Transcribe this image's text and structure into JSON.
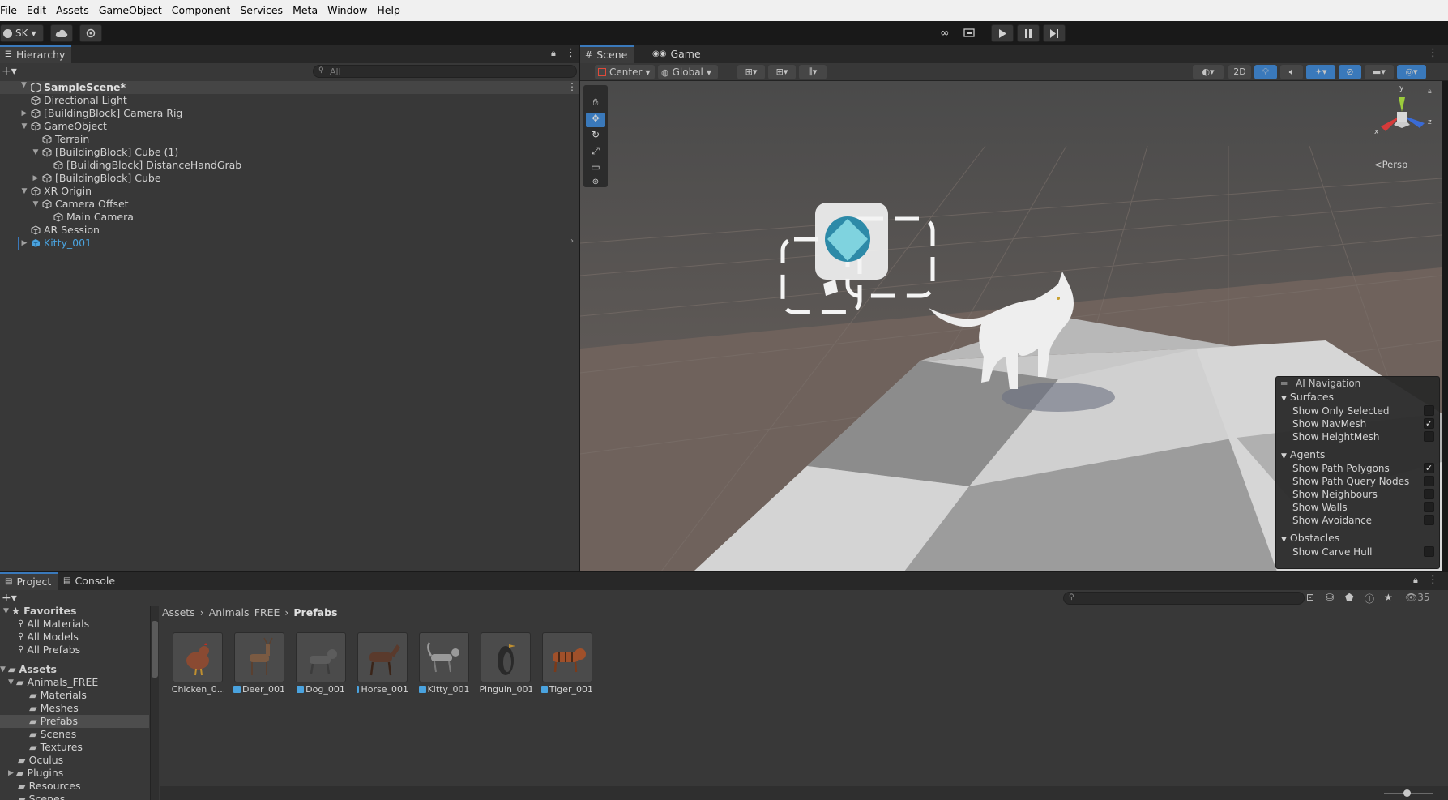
{
  "menu": [
    "File",
    "Edit",
    "Assets",
    "GameObject",
    "Component",
    "Services",
    "Meta",
    "Window",
    "Help"
  ],
  "toolbar": {
    "account": "SK"
  },
  "hierarchy": {
    "tab": "Hierarchy",
    "search_placeholder": "All",
    "scene": "SampleScene*",
    "items": [
      {
        "label": "Directional Light"
      },
      {
        "label": "[BuildingBlock] Camera Rig"
      },
      {
        "label": "GameObject"
      },
      {
        "label": "Terrain"
      },
      {
        "label": "[BuildingBlock] Cube (1)"
      },
      {
        "label": "[BuildingBlock] DistanceHandGrab"
      },
      {
        "label": "[BuildingBlock] Cube"
      },
      {
        "label": "XR Origin"
      },
      {
        "label": "Camera Offset"
      },
      {
        "label": "Main Camera"
      },
      {
        "label": "AR Session"
      },
      {
        "label": "Kitty_001"
      }
    ]
  },
  "scene_view": {
    "tabs": [
      "Scene",
      "Game"
    ],
    "pivot": "Center",
    "space": "Global",
    "mode_2d": "2D",
    "projection": "Persp",
    "gizmo_axes": {
      "x": "x",
      "y": "y",
      "z": "z"
    }
  },
  "ai_navigation": {
    "title": "AI Navigation",
    "sections": [
      {
        "header": "Surfaces",
        "items": [
          {
            "label": "Show Only Selected",
            "checked": false
          },
          {
            "label": "Show NavMesh",
            "checked": true
          },
          {
            "label": "Show HeightMesh",
            "checked": false
          }
        ]
      },
      {
        "header": "Agents",
        "items": [
          {
            "label": "Show Path Polygons",
            "checked": true
          },
          {
            "label": "Show Path Query Nodes",
            "checked": false
          },
          {
            "label": "Show Neighbours",
            "checked": false
          },
          {
            "label": "Show Walls",
            "checked": false
          },
          {
            "label": "Show Avoidance",
            "checked": false
          }
        ]
      },
      {
        "header": "Obstacles",
        "items": [
          {
            "label": "Show Carve Hull",
            "checked": false
          }
        ]
      }
    ]
  },
  "project": {
    "tabs": [
      "Project",
      "Console"
    ],
    "hidden_count": "35",
    "breadcrumb": [
      "Assets",
      "Animals_FREE",
      "Prefabs"
    ],
    "favorites": {
      "label": "Favorites",
      "items": [
        "All Materials",
        "All Models",
        "All Prefabs"
      ]
    },
    "assets_root": "Assets",
    "tree": [
      {
        "label": "Animals_FREE"
      },
      {
        "label": "Materials"
      },
      {
        "label": "Meshes"
      },
      {
        "label": "Prefabs"
      },
      {
        "label": "Scenes"
      },
      {
        "label": "Textures"
      },
      {
        "label": "Oculus"
      },
      {
        "label": "Plugins"
      },
      {
        "label": "Resources"
      },
      {
        "label": "Scenes"
      }
    ],
    "assets": [
      {
        "label": "Chicken_0...",
        "color": "#8a4a32"
      },
      {
        "label": "Deer_001",
        "color": "#7a5a42"
      },
      {
        "label": "Dog_001",
        "color": "#5c5c5c"
      },
      {
        "label": "Horse_001",
        "color": "#5a3a2c"
      },
      {
        "label": "Kitty_001",
        "color": "#9a9a9a"
      },
      {
        "label": "Pinguin_001",
        "color": "#2a2a2a"
      },
      {
        "label": "Tiger_001",
        "color": "#a0502a"
      }
    ]
  },
  "colors": {
    "accent": "#3a79bb",
    "panel": "#383838",
    "selected_text": "#4aa3df"
  }
}
